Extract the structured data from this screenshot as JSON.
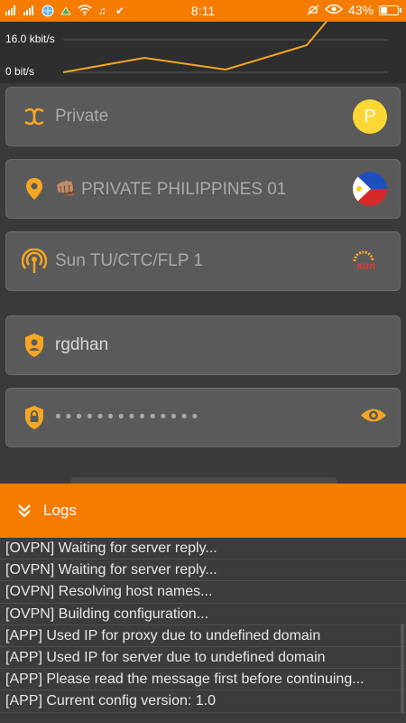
{
  "status_bar": {
    "time": "8:11",
    "battery": "43%",
    "battery_level": 0.43,
    "left_icons": [
      "signal-icon",
      "signal-icon",
      "globe-icon",
      "app-icon",
      "wifi-icon",
      "music-icon",
      "check-icon"
    ],
    "right_icons": [
      "mute-icon",
      "eye-icon",
      "battery-icon"
    ]
  },
  "graph": {
    "y_top_label": "16.0 kbit/s",
    "y_bottom_label": "0 bit/s",
    "line_color": "#f5a623"
  },
  "fields": {
    "payload": {
      "label": "Private",
      "badge": "P",
      "icon": "payload-icon"
    },
    "server": {
      "label": "PRIVATE PHILIPPINES 01",
      "emoji": "👊🏽",
      "icon": "location-pin-icon",
      "flag": "philippines-flag"
    },
    "network": {
      "label": "Sun TU/CTC/FLP 1",
      "icon": "broadcast-icon",
      "logo": "sun"
    },
    "username": {
      "value": "rgdhan",
      "icon": "user-shield-icon"
    },
    "password": {
      "value": "••••••••••••••",
      "icon": "lock-shield-icon",
      "toggle_icon": "eye-icon"
    }
  },
  "logs": {
    "title": "Logs",
    "entries": [
      "[OVPN] Waiting for server reply...",
      "[OVPN] Waiting for server reply...",
      "[OVPN] Resolving host names...",
      "[OVPN] Building configuration...",
      "[APP] Used IP for proxy due to undefined domain",
      "[APP] Used IP for server due to undefined domain",
      "[APP] Please read the message first before continuing...",
      "[APP] Current config version: 1.0"
    ]
  },
  "colors": {
    "accent": "#f57c00",
    "icon": "#f5a623",
    "background": "#3a3a3a"
  }
}
